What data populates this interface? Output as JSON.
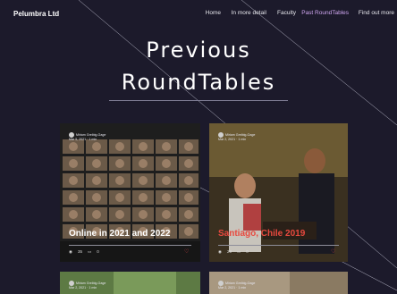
{
  "nav": {
    "brand": "Pelumbra Ltd",
    "links": [
      {
        "label": "Home",
        "active": false
      },
      {
        "label": "In more detail",
        "active": false
      },
      {
        "label": "Faculty",
        "active": false
      },
      {
        "label": "Past RoundTables",
        "active": true
      },
      {
        "label": "Find out more",
        "active": false
      }
    ]
  },
  "hero": {
    "line1": "Previous",
    "line2": "RoundTables"
  },
  "cards": [
    {
      "author": "Miriam Greibig-Gage",
      "date": "Mar 5, 2021",
      "read_time": "1 min",
      "title": "Online in 2021 and 2022",
      "views": "35",
      "comments": "0",
      "title_color": "#ffffff"
    },
    {
      "author": "Miriam Greibig-Gage",
      "date": "Mar 2, 2021",
      "read_time": "1 min",
      "title": "Santiago, Chile 2019",
      "views": "29",
      "comments": "0",
      "title_color": "#e8493e"
    },
    {
      "author": "Miriam Greibig-Gage",
      "date": "Mar 2, 2021",
      "read_time": "1 min"
    },
    {
      "author": "Miriam Greibig-Gage",
      "date": "Mar 2, 2021",
      "read_time": "1 min"
    }
  ],
  "colors": {
    "background": "#1c1a2b",
    "nav_active": "#cfa6f0",
    "heart": "#f04a4a"
  }
}
